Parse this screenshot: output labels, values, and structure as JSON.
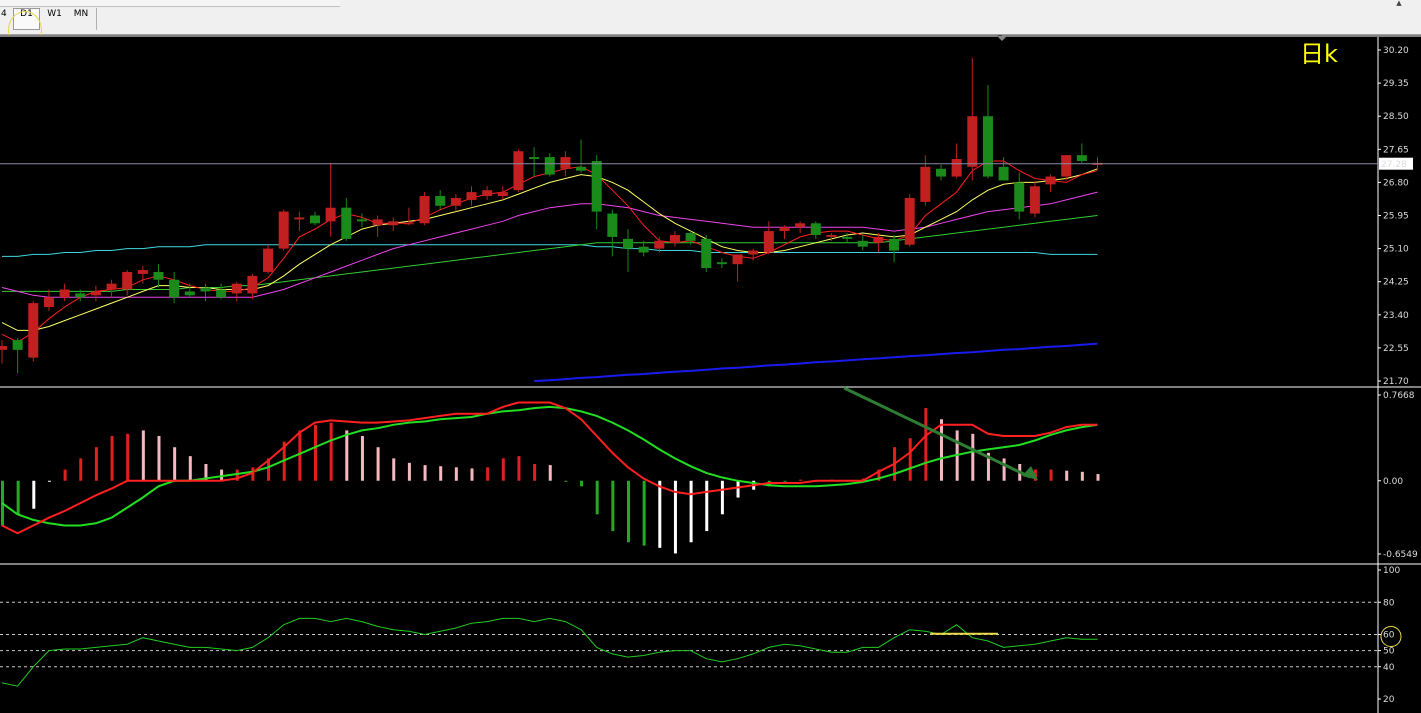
{
  "toolbar": {
    "tabs": [
      {
        "label": "4",
        "active": false
      },
      {
        "label": "D1",
        "active": true
      },
      {
        "label": "W1",
        "active": false
      },
      {
        "label": "MN",
        "active": false
      }
    ],
    "scroll_arrow": "▲"
  },
  "colors": {
    "background": "#000000",
    "bull_candle": "#1a8a1a",
    "bear_candle": "#c22020",
    "ma_fast": "#ff2020",
    "ma_mid": "#ffff66",
    "ma_slow": "#ee44ee",
    "ma_60": "#33cc33",
    "ma_120": "#40d8e0",
    "ma_250": "#1a1aee",
    "macd_line": "#ff2020",
    "signal_line": "#22dd22",
    "rsi_line": "#22cc22",
    "annotation_arrow": "#2e7d32",
    "annotation_highlight": "#e8d84a"
  },
  "chart_data": [
    {
      "type": "candlestick",
      "watermark": "日k",
      "y_ticks": [
        "30.20",
        "29.35",
        "28.50",
        "27.65",
        "26.80",
        "25.95",
        "25.10",
        "24.25",
        "23.40",
        "22.55",
        "21.70"
      ],
      "ylim": [
        21.7,
        30.2
      ],
      "current_price": "27.28",
      "ohlc": [
        [
          22.5,
          22.75,
          22.15,
          22.6
        ],
        [
          22.75,
          22.8,
          21.9,
          22.5
        ],
        [
          22.3,
          23.75,
          22.2,
          23.7
        ],
        [
          23.6,
          24.05,
          23.5,
          23.85
        ],
        [
          23.85,
          24.2,
          23.75,
          24.05
        ],
        [
          23.95,
          24.05,
          23.75,
          23.85
        ],
        [
          23.9,
          24.15,
          23.75,
          24.0
        ],
        [
          24.05,
          24.3,
          23.85,
          24.2
        ],
        [
          24.05,
          24.55,
          23.9,
          24.5
        ],
        [
          24.45,
          24.65,
          24.2,
          24.55
        ],
        [
          24.5,
          24.7,
          24.1,
          24.3
        ],
        [
          24.3,
          24.5,
          23.7,
          23.85
        ],
        [
          24.0,
          24.2,
          23.85,
          23.9
        ],
        [
          24.1,
          24.2,
          23.75,
          24.0
        ],
        [
          24.05,
          24.2,
          23.8,
          23.85
        ],
        [
          23.95,
          24.25,
          23.75,
          24.2
        ],
        [
          23.95,
          24.45,
          23.8,
          24.4
        ],
        [
          24.5,
          25.2,
          24.45,
          25.1
        ],
        [
          25.1,
          26.1,
          25.05,
          26.05
        ],
        [
          25.85,
          26.05,
          25.55,
          25.9
        ],
        [
          25.95,
          26.05,
          25.7,
          25.75
        ],
        [
          25.8,
          27.3,
          25.4,
          26.15
        ],
        [
          26.15,
          26.4,
          25.3,
          25.35
        ],
        [
          25.85,
          26.0,
          25.65,
          25.8
        ],
        [
          25.7,
          25.95,
          25.4,
          25.85
        ],
        [
          25.7,
          25.9,
          25.55,
          25.8
        ],
        [
          25.75,
          26.15,
          25.7,
          25.75
        ],
        [
          25.75,
          26.55,
          25.7,
          26.45
        ],
        [
          26.45,
          26.6,
          26.1,
          26.2
        ],
        [
          26.2,
          26.5,
          26.05,
          26.4
        ],
        [
          26.35,
          26.7,
          26.2,
          26.55
        ],
        [
          26.45,
          26.7,
          26.35,
          26.6
        ],
        [
          26.45,
          26.7,
          26.35,
          26.55
        ],
        [
          26.6,
          27.65,
          26.55,
          27.6
        ],
        [
          27.45,
          27.7,
          26.95,
          27.4
        ],
        [
          27.45,
          27.55,
          26.95,
          27.0
        ],
        [
          27.15,
          27.6,
          26.95,
          27.45
        ],
        [
          27.2,
          27.9,
          27.05,
          27.1
        ],
        [
          27.35,
          27.5,
          25.6,
          26.05
        ],
        [
          26.0,
          26.1,
          24.9,
          25.4
        ],
        [
          25.35,
          25.6,
          24.5,
          25.1
        ],
        [
          25.15,
          25.3,
          24.9,
          25.0
        ],
        [
          25.1,
          25.4,
          25.0,
          25.3
        ],
        [
          25.25,
          25.55,
          25.15,
          25.45
        ],
        [
          25.5,
          25.55,
          25.2,
          25.3
        ],
        [
          25.35,
          25.45,
          24.5,
          24.6
        ],
        [
          24.75,
          24.85,
          24.6,
          24.7
        ],
        [
          24.7,
          24.95,
          24.25,
          24.95
        ],
        [
          24.95,
          25.1,
          24.8,
          25.05
        ],
        [
          25.0,
          25.8,
          24.95,
          25.55
        ],
        [
          25.55,
          25.7,
          25.35,
          25.65
        ],
        [
          25.65,
          25.8,
          25.5,
          25.75
        ],
        [
          25.75,
          25.8,
          25.35,
          25.45
        ],
        [
          25.4,
          25.5,
          25.3,
          25.45
        ],
        [
          25.4,
          25.5,
          25.25,
          25.35
        ],
        [
          25.3,
          25.45,
          25.05,
          25.15
        ],
        [
          25.25,
          25.5,
          25.0,
          25.4
        ],
        [
          25.35,
          25.45,
          24.75,
          25.05
        ],
        [
          25.2,
          26.5,
          25.15,
          26.4
        ],
        [
          26.3,
          27.5,
          26.2,
          27.2
        ],
        [
          27.15,
          27.25,
          26.85,
          26.95
        ],
        [
          26.95,
          27.8,
          26.9,
          27.4
        ],
        [
          27.2,
          30.0,
          26.85,
          28.5
        ],
        [
          28.5,
          29.3,
          26.9,
          26.95
        ],
        [
          27.2,
          27.45,
          26.85,
          26.85
        ],
        [
          26.8,
          27.05,
          25.85,
          26.05
        ],
        [
          26.0,
          26.85,
          25.9,
          26.7
        ],
        [
          26.75,
          27.0,
          26.55,
          26.95
        ],
        [
          26.95,
          27.5,
          26.85,
          27.5
        ],
        [
          27.5,
          27.8,
          27.3,
          27.35
        ],
        [
          27.25,
          27.45,
          27.15,
          27.3
        ]
      ],
      "ma5": [
        22.9,
        22.7,
        22.95,
        23.3,
        23.6,
        23.85,
        24.0,
        24.05,
        24.1,
        24.3,
        24.4,
        24.3,
        24.15,
        24.05,
        24.0,
        24.0,
        24.1,
        24.35,
        24.85,
        25.4,
        25.6,
        25.85,
        26.0,
        25.9,
        25.75,
        25.75,
        25.75,
        25.9,
        26.1,
        26.25,
        26.4,
        26.5,
        26.55,
        26.75,
        26.95,
        27.05,
        27.15,
        27.2,
        27.0,
        26.6,
        26.2,
        25.7,
        25.3,
        25.25,
        25.3,
        25.15,
        25.0,
        24.9,
        24.85,
        25.0,
        25.2,
        25.4,
        25.5,
        25.55,
        25.55,
        25.45,
        25.35,
        25.3,
        25.45,
        25.95,
        26.25,
        26.55,
        27.1,
        27.35,
        27.35,
        27.1,
        26.9,
        26.85,
        26.8,
        27.0,
        27.1
      ],
      "ma10": [
        23.2,
        23.0,
        23.0,
        23.1,
        23.25,
        23.4,
        23.55,
        23.7,
        23.85,
        24.0,
        24.15,
        24.15,
        24.1,
        24.1,
        24.05,
        24.05,
        24.05,
        24.15,
        24.4,
        24.7,
        24.95,
        25.2,
        25.4,
        25.6,
        25.7,
        25.75,
        25.8,
        25.85,
        25.95,
        26.05,
        26.15,
        26.25,
        26.35,
        26.5,
        26.65,
        26.8,
        26.9,
        27.0,
        26.95,
        26.8,
        26.6,
        26.3,
        26.0,
        25.75,
        25.55,
        25.35,
        25.15,
        25.05,
        25.0,
        25.0,
        25.05,
        25.15,
        25.25,
        25.35,
        25.45,
        25.5,
        25.45,
        25.4,
        25.45,
        25.65,
        25.85,
        26.05,
        26.35,
        26.6,
        26.75,
        26.8,
        26.8,
        26.85,
        26.9,
        27.0,
        27.15
      ],
      "ma20": [
        24.1,
        24.0,
        23.9,
        23.85,
        23.85,
        23.85,
        23.85,
        23.85,
        23.85,
        23.85,
        23.85,
        23.85,
        23.85,
        23.85,
        23.85,
        23.85,
        23.85,
        23.95,
        24.05,
        24.2,
        24.35,
        24.5,
        24.65,
        24.8,
        24.95,
        25.1,
        25.2,
        25.3,
        25.4,
        25.5,
        25.6,
        25.7,
        25.8,
        25.95,
        26.05,
        26.15,
        26.2,
        26.25,
        26.25,
        26.2,
        26.15,
        26.05,
        25.95,
        25.9,
        25.85,
        25.8,
        25.75,
        25.7,
        25.65,
        25.65,
        25.65,
        25.65,
        25.65,
        25.65,
        25.65,
        25.65,
        25.6,
        25.55,
        25.6,
        25.65,
        25.75,
        25.85,
        25.95,
        26.05,
        26.1,
        26.15,
        26.2,
        26.25,
        26.35,
        26.45,
        26.55
      ],
      "ma60": [
        24.0,
        24.0,
        24.0,
        24.0,
        24.0,
        24.0,
        24.0,
        24.0,
        24.05,
        24.05,
        24.05,
        24.05,
        24.1,
        24.1,
        24.1,
        24.15,
        24.15,
        24.2,
        24.25,
        24.3,
        24.35,
        24.4,
        24.45,
        24.5,
        24.55,
        24.6,
        24.65,
        24.7,
        24.75,
        24.8,
        24.85,
        24.9,
        24.95,
        25.0,
        25.05,
        25.1,
        25.15,
        25.2,
        25.25,
        25.25,
        25.25,
        25.25,
        25.25,
        25.25,
        25.25,
        25.25,
        25.25,
        25.25,
        25.25,
        25.25,
        25.25,
        25.25,
        25.25,
        25.25,
        25.25,
        25.25,
        25.25,
        25.3,
        25.35,
        25.4,
        25.45,
        25.5,
        25.55,
        25.6,
        25.65,
        25.7,
        25.75,
        25.8,
        25.85,
        25.9,
        25.95
      ],
      "ma120": [
        24.9,
        24.9,
        24.95,
        24.95,
        25.0,
        25.0,
        25.05,
        25.05,
        25.1,
        25.1,
        25.15,
        25.15,
        25.15,
        25.2,
        25.2,
        25.2,
        25.2,
        25.2,
        25.2,
        25.2,
        25.2,
        25.2,
        25.2,
        25.2,
        25.2,
        25.2,
        25.2,
        25.2,
        25.2,
        25.2,
        25.2,
        25.2,
        25.2,
        25.2,
        25.2,
        25.2,
        25.2,
        25.2,
        25.15,
        25.15,
        25.1,
        25.1,
        25.05,
        25.05,
        25.05,
        25.0,
        25.0,
        25.0,
        25.0,
        25.0,
        25.0,
        25.0,
        25.0,
        25.0,
        25.0,
        25.0,
        25.0,
        25.0,
        25.0,
        25.0,
        25.0,
        25.0,
        25.0,
        25.0,
        25.0,
        25.0,
        25.0,
        24.95,
        24.95,
        24.95,
        24.95
      ],
      "ma250": [
        null,
        null,
        null,
        null,
        null,
        null,
        null,
        null,
        null,
        null,
        null,
        null,
        null,
        null,
        null,
        null,
        null,
        null,
        null,
        null,
        null,
        null,
        null,
        null,
        null,
        null,
        null,
        null,
        null,
        null,
        null,
        null,
        null,
        null,
        21.7,
        21.72,
        21.75,
        21.78,
        21.8,
        21.83,
        21.86,
        21.88,
        21.91,
        21.94,
        21.96,
        21.99,
        22.02,
        22.04,
        22.07,
        22.1,
        22.12,
        22.15,
        22.18,
        22.2,
        22.23,
        22.26,
        22.28,
        22.31,
        22.34,
        22.36,
        22.39,
        22.42,
        22.44,
        22.47,
        22.5,
        22.52,
        22.55,
        22.58,
        22.6,
        22.63,
        22.66
      ]
    },
    {
      "type": "macd",
      "y_ticks": [
        "0.7668",
        "0.00",
        "-0.6549"
      ],
      "ylim": [
        -0.6549,
        0.7668
      ],
      "histogram": [
        -0.4,
        -0.3,
        -0.25,
        0.0,
        0.1,
        0.2,
        0.3,
        0.4,
        0.42,
        0.45,
        0.4,
        0.3,
        0.22,
        0.15,
        0.1,
        0.1,
        0.12,
        0.2,
        0.35,
        0.45,
        0.5,
        0.52,
        0.45,
        0.4,
        0.3,
        0.2,
        0.16,
        0.14,
        0.13,
        0.12,
        0.11,
        0.12,
        0.2,
        0.22,
        0.15,
        0.14,
        0.0,
        -0.05,
        -0.3,
        -0.45,
        -0.55,
        -0.58,
        -0.6,
        -0.65,
        -0.55,
        -0.45,
        -0.3,
        -0.15,
        -0.08,
        -0.05,
        0.0,
        0.01,
        0.0,
        0.01,
        0.0,
        0.02,
        0.1,
        0.3,
        0.38,
        0.65,
        0.55,
        0.45,
        0.42,
        0.25,
        0.2,
        0.15,
        0.1,
        0.1,
        0.09,
        0.08,
        0.06
      ],
      "hist_colors": [
        "green",
        "green",
        "white",
        "white",
        "red",
        "red",
        "red",
        "red",
        "red",
        "pink",
        "pink",
        "pink",
        "pink",
        "pink",
        "pink",
        "red",
        "red",
        "red",
        "red",
        "red",
        "red",
        "red",
        "pink",
        "pink",
        "pink",
        "pink",
        "pink",
        "pink",
        "pink",
        "pink",
        "pink",
        "red",
        "red",
        "red",
        "red",
        "pink",
        "green",
        "green",
        "green",
        "green",
        "green",
        "green",
        "white",
        "white",
        "white",
        "white",
        "white",
        "white",
        "white",
        "green",
        "green",
        "red",
        "red",
        "red",
        "red",
        "red",
        "red",
        "red",
        "red",
        "red",
        "pink",
        "pink",
        "pink",
        "pink",
        "pink",
        "pink",
        "red",
        "red",
        "pink",
        "pink",
        "pink"
      ],
      "macd": [
        -0.4,
        -0.47,
        -0.4,
        -0.33,
        -0.27,
        -0.2,
        -0.13,
        -0.07,
        0.0,
        0.0,
        0.0,
        0.0,
        0.0,
        0.0,
        0.0,
        0.02,
        0.07,
        0.18,
        0.3,
        0.43,
        0.52,
        0.54,
        0.53,
        0.52,
        0.52,
        0.53,
        0.54,
        0.56,
        0.58,
        0.6,
        0.6,
        0.6,
        0.66,
        0.7,
        0.7,
        0.7,
        0.65,
        0.55,
        0.4,
        0.25,
        0.12,
        0.02,
        -0.05,
        -0.1,
        -0.12,
        -0.1,
        -0.08,
        -0.06,
        -0.04,
        -0.02,
        -0.02,
        -0.02,
        0.0,
        0.0,
        0.0,
        0.0,
        0.08,
        0.15,
        0.25,
        0.4,
        0.5,
        0.5,
        0.5,
        0.42,
        0.4,
        0.4,
        0.4,
        0.43,
        0.48,
        0.5,
        0.5
      ],
      "signal": [
        -0.2,
        -0.3,
        -0.35,
        -0.38,
        -0.4,
        -0.4,
        -0.38,
        -0.33,
        -0.24,
        -0.15,
        -0.05,
        0.0,
        0.0,
        0.02,
        0.04,
        0.06,
        0.08,
        0.12,
        0.18,
        0.24,
        0.3,
        0.36,
        0.41,
        0.45,
        0.47,
        0.5,
        0.52,
        0.53,
        0.55,
        0.56,
        0.57,
        0.6,
        0.62,
        0.63,
        0.65,
        0.66,
        0.65,
        0.62,
        0.58,
        0.52,
        0.45,
        0.37,
        0.28,
        0.2,
        0.13,
        0.07,
        0.03,
        0.0,
        -0.02,
        -0.04,
        -0.05,
        -0.05,
        -0.05,
        -0.04,
        -0.03,
        -0.01,
        0.02,
        0.06,
        0.11,
        0.16,
        0.2,
        0.23,
        0.26,
        0.28,
        0.3,
        0.32,
        0.36,
        0.41,
        0.45,
        0.48,
        0.5
      ]
    },
    {
      "type": "line",
      "y_ticks": [
        "100",
        "80",
        "60",
        "50",
        "40",
        "20"
      ],
      "ylim": [
        20,
        100
      ],
      "dashed_levels": [
        80,
        60,
        50,
        40
      ],
      "values": [
        30,
        28,
        40,
        50,
        51,
        51,
        52,
        53,
        54,
        58,
        56,
        54,
        52,
        52,
        51,
        50,
        52,
        58,
        66,
        70,
        70,
        68,
        70,
        68,
        65,
        63,
        62,
        60,
        62,
        64,
        67,
        68,
        70,
        70,
        68,
        70,
        68,
        63,
        52,
        48,
        46,
        47,
        49,
        50,
        50,
        45,
        43,
        45,
        48,
        52,
        54,
        53,
        51,
        49,
        49,
        52,
        52,
        58,
        63,
        62,
        60,
        66,
        58,
        56,
        52,
        53,
        54,
        56,
        58,
        57,
        57
      ]
    }
  ]
}
